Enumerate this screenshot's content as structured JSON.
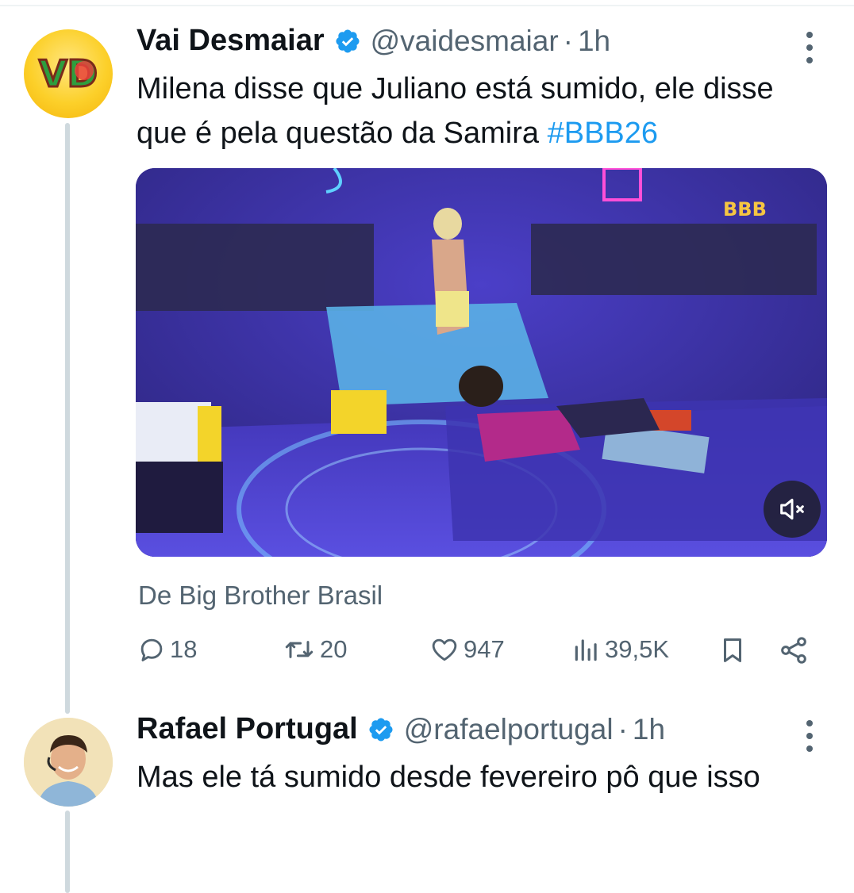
{
  "tweets": [
    {
      "author_name": "Vai Desmaiar",
      "handle": "@vaidesmaiar",
      "separator": "·",
      "time": "1h",
      "text": "Milena disse que Juliano está sumido, ele disse que é pela questão da Samira ",
      "hashtag": "#BBB26",
      "avatar_text": "VD",
      "media": {
        "watermark": "BBB",
        "mute_icon": "mute-icon"
      },
      "source": "De Big Brother Brasil",
      "metrics": {
        "replies": "18",
        "reposts": "20",
        "likes": "947",
        "views": "39,5K"
      }
    },
    {
      "author_name": "Rafael Portugal",
      "handle": "@rafaelportugal",
      "separator": "·",
      "time": "1h",
      "text": "Mas ele tá sumido desde fevereiro pô que isso"
    }
  ],
  "colors": {
    "verified": "#1d9bf0",
    "hashtag": "#1d9bf0",
    "secondary_text": "#536471",
    "thread_line": "#cfd9de"
  }
}
